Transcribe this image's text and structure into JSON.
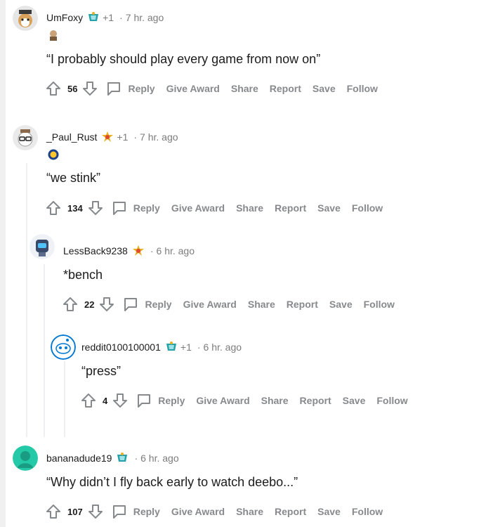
{
  "comments": [
    {
      "username": "UmFoxy",
      "plus": "+1",
      "sep": "·",
      "time": "7 hr. ago",
      "body": "“I probably should play every game from now on”",
      "votes": "56"
    },
    {
      "username": "_Paul_Rust",
      "plus": "+1",
      "sep": "·",
      "time": "7 hr. ago",
      "body": "“we stink”",
      "votes": "134"
    },
    {
      "username": "LessBack9238",
      "plus": "",
      "sep": "·",
      "time": "6 hr. ago",
      "body": "*bench",
      "votes": "22"
    },
    {
      "username": "reddit0100100001",
      "plus": "+1",
      "sep": "·",
      "time": "6 hr. ago",
      "body": "“press”",
      "votes": "4"
    },
    {
      "username": "bananadude19",
      "plus": "",
      "sep": "·",
      "time": "6 hr. ago",
      "body": "“Why didn’t I fly back early to watch deebo...”",
      "votes": "107"
    }
  ],
  "actions": {
    "reply": "Reply",
    "give_award": "Give Award",
    "share": "Share",
    "report": "Report",
    "save": "Save",
    "follow": "Follow"
  },
  "colors": {
    "vote_icon": "#878a8c",
    "accent_teal": "#24a0a8",
    "award_gold": "#e8b122"
  }
}
